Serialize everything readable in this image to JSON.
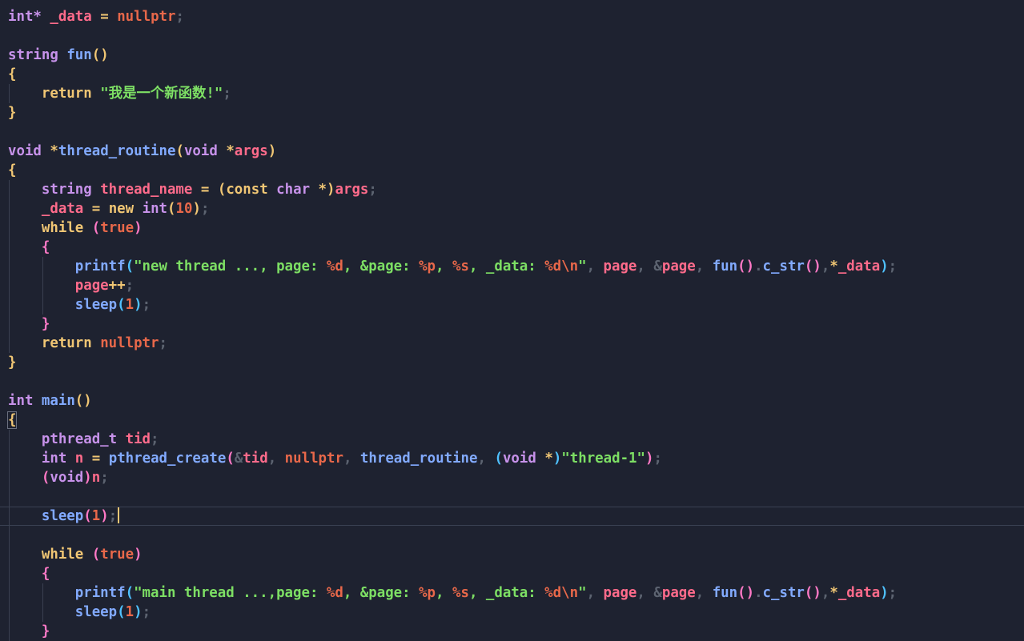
{
  "editor": {
    "lines": [
      [
        [
          "int*",
          "#c792ea"
        ],
        [
          " ",
          ""
        ],
        [
          "_data",
          "#ff6b8b"
        ],
        [
          " ",
          ""
        ],
        [
          "=",
          "#f0c674"
        ],
        [
          " ",
          ""
        ],
        [
          "nullptr",
          "#e8684a"
        ],
        [
          ";",
          "#5c6370"
        ]
      ],
      [],
      [
        [
          "string",
          "#c792ea"
        ],
        [
          " ",
          ""
        ],
        [
          "fun",
          "#82aaff"
        ],
        [
          "()",
          "#f0c674"
        ]
      ],
      [
        [
          "{",
          "#f0c674"
        ]
      ],
      [
        [
          "    ",
          ""
        ],
        [
          "return",
          "#f0c674"
        ],
        [
          " ",
          ""
        ],
        [
          "\"我是一个新函数!\"",
          "#7ddf64"
        ],
        [
          ";",
          "#5c6370"
        ]
      ],
      [
        [
          "}",
          "#f0c674"
        ]
      ],
      [],
      [
        [
          "void",
          "#c792ea"
        ],
        [
          " ",
          ""
        ],
        [
          "*",
          "#f0c674"
        ],
        [
          "thread_routine",
          "#82aaff"
        ],
        [
          "(",
          "#f0c674"
        ],
        [
          "void",
          "#c792ea"
        ],
        [
          " ",
          ""
        ],
        [
          "*",
          "#f0c674"
        ],
        [
          "args",
          "#ff6b8b"
        ],
        [
          ")",
          "#f0c674"
        ]
      ],
      [
        [
          "{",
          "#f0c674"
        ]
      ],
      [
        [
          "    ",
          ""
        ],
        [
          "string",
          "#c792ea"
        ],
        [
          " ",
          ""
        ],
        [
          "thread_name",
          "#ff6b8b"
        ],
        [
          " ",
          ""
        ],
        [
          "=",
          "#f0c674"
        ],
        [
          " ",
          ""
        ],
        [
          "(",
          "#f0c674"
        ],
        [
          "const",
          "#f0c674"
        ],
        [
          " ",
          ""
        ],
        [
          "char",
          "#c792ea"
        ],
        [
          " ",
          ""
        ],
        [
          "*",
          "#f0c674"
        ],
        [
          ")",
          "#f0c674"
        ],
        [
          "args",
          "#ff6b8b"
        ],
        [
          ";",
          "#5c6370"
        ]
      ],
      [
        [
          "    ",
          ""
        ],
        [
          "_data",
          "#ff6b8b"
        ],
        [
          " ",
          ""
        ],
        [
          "=",
          "#f0c674"
        ],
        [
          " ",
          ""
        ],
        [
          "new",
          "#f0c674"
        ],
        [
          " ",
          ""
        ],
        [
          "int",
          "#c792ea"
        ],
        [
          "(",
          "#f0c674"
        ],
        [
          "10",
          "#e8684a"
        ],
        [
          ")",
          "#f0c674"
        ],
        [
          ";",
          "#5c6370"
        ]
      ],
      [
        [
          "    ",
          ""
        ],
        [
          "while",
          "#f0c674"
        ],
        [
          " ",
          ""
        ],
        [
          "(",
          "#ff79c6"
        ],
        [
          "true",
          "#e8684a"
        ],
        [
          ")",
          "#ff79c6"
        ]
      ],
      [
        [
          "    ",
          ""
        ],
        [
          "{",
          "#ff79c6"
        ]
      ],
      [
        [
          "        ",
          ""
        ],
        [
          "printf",
          "#82aaff"
        ],
        [
          "(",
          "#4fc1ff"
        ],
        [
          "\"new thread ..., page: ",
          "#7ddf64"
        ],
        [
          "%d",
          "#e8684a"
        ],
        [
          ", &page: ",
          "#7ddf64"
        ],
        [
          "%p",
          "#e8684a"
        ],
        [
          ", ",
          "#7ddf64"
        ],
        [
          "%s",
          "#e8684a"
        ],
        [
          ", _data: ",
          "#7ddf64"
        ],
        [
          "%d",
          "#e8684a"
        ],
        [
          "\\n",
          "#e8684a"
        ],
        [
          "\"",
          "#7ddf64"
        ],
        [
          ", ",
          "#5c6370"
        ],
        [
          "page",
          "#ff6b8b"
        ],
        [
          ", ",
          "#5c6370"
        ],
        [
          "&",
          "#5c6370"
        ],
        [
          "page",
          "#ff6b8b"
        ],
        [
          ", ",
          "#5c6370"
        ],
        [
          "fun",
          "#82aaff"
        ],
        [
          "()",
          "#ff79c6"
        ],
        [
          ".",
          "#5c6370"
        ],
        [
          "c_str",
          "#82aaff"
        ],
        [
          "()",
          "#ff79c6"
        ],
        [
          ",",
          "#5c6370"
        ],
        [
          "*",
          "#f0c674"
        ],
        [
          "_data",
          "#ff6b8b"
        ],
        [
          ")",
          "#4fc1ff"
        ],
        [
          ";",
          "#5c6370"
        ]
      ],
      [
        [
          "        ",
          ""
        ],
        [
          "page",
          "#ff6b8b"
        ],
        [
          "++",
          "#f0c674"
        ],
        [
          ";",
          "#5c6370"
        ]
      ],
      [
        [
          "        ",
          ""
        ],
        [
          "sleep",
          "#82aaff"
        ],
        [
          "(",
          "#4fc1ff"
        ],
        [
          "1",
          "#e8684a"
        ],
        [
          ")",
          "#4fc1ff"
        ],
        [
          ";",
          "#5c6370"
        ]
      ],
      [
        [
          "    ",
          ""
        ],
        [
          "}",
          "#ff79c6"
        ]
      ],
      [
        [
          "    ",
          ""
        ],
        [
          "return",
          "#f0c674"
        ],
        [
          " ",
          ""
        ],
        [
          "nullptr",
          "#e8684a"
        ],
        [
          ";",
          "#5c6370"
        ]
      ],
      [
        [
          "}",
          "#f0c674"
        ]
      ],
      [],
      [
        [
          "int",
          "#c792ea"
        ],
        [
          " ",
          ""
        ],
        [
          "main",
          "#82aaff"
        ],
        [
          "()",
          "#f0c674"
        ]
      ],
      [
        [
          "{",
          "#f0c674"
        ]
      ],
      [
        [
          "    ",
          ""
        ],
        [
          "pthread_t",
          "#c792ea"
        ],
        [
          " ",
          ""
        ],
        [
          "tid",
          "#ff6b8b"
        ],
        [
          ";",
          "#5c6370"
        ]
      ],
      [
        [
          "    ",
          ""
        ],
        [
          "int",
          "#c792ea"
        ],
        [
          " ",
          ""
        ],
        [
          "n",
          "#ff6b8b"
        ],
        [
          " ",
          ""
        ],
        [
          "=",
          "#f0c674"
        ],
        [
          " ",
          ""
        ],
        [
          "pthread_create",
          "#82aaff"
        ],
        [
          "(",
          "#ff79c6"
        ],
        [
          "&",
          "#5c6370"
        ],
        [
          "tid",
          "#ff6b8b"
        ],
        [
          ", ",
          "#5c6370"
        ],
        [
          "nullptr",
          "#e8684a"
        ],
        [
          ", ",
          "#5c6370"
        ],
        [
          "thread_routine",
          "#82aaff"
        ],
        [
          ", ",
          "#5c6370"
        ],
        [
          "(",
          "#4fc1ff"
        ],
        [
          "void",
          "#c792ea"
        ],
        [
          " ",
          ""
        ],
        [
          "*",
          "#f0c674"
        ],
        [
          ")",
          "#4fc1ff"
        ],
        [
          "\"thread-1\"",
          "#7ddf64"
        ],
        [
          ")",
          "#ff79c6"
        ],
        [
          ";",
          "#5c6370"
        ]
      ],
      [
        [
          "    ",
          ""
        ],
        [
          "(",
          "#ff79c6"
        ],
        [
          "void",
          "#c792ea"
        ],
        [
          ")",
          "#ff79c6"
        ],
        [
          "n",
          "#ff6b8b"
        ],
        [
          ";",
          "#5c6370"
        ]
      ],
      [],
      [
        [
          "    ",
          ""
        ],
        [
          "sleep",
          "#82aaff"
        ],
        [
          "(",
          "#ff79c6"
        ],
        [
          "1",
          "#e8684a"
        ],
        [
          ")",
          "#ff79c6"
        ],
        [
          ";",
          "#5c6370"
        ]
      ],
      [],
      [
        [
          "    ",
          ""
        ],
        [
          "while",
          "#f0c674"
        ],
        [
          " ",
          ""
        ],
        [
          "(",
          "#ff79c6"
        ],
        [
          "true",
          "#e8684a"
        ],
        [
          ")",
          "#ff79c6"
        ]
      ],
      [
        [
          "    ",
          ""
        ],
        [
          "{",
          "#ff79c6"
        ]
      ],
      [
        [
          "        ",
          ""
        ],
        [
          "printf",
          "#82aaff"
        ],
        [
          "(",
          "#4fc1ff"
        ],
        [
          "\"main thread ...,page: ",
          "#7ddf64"
        ],
        [
          "%d",
          "#e8684a"
        ],
        [
          ", &page: ",
          "#7ddf64"
        ],
        [
          "%p",
          "#e8684a"
        ],
        [
          ", ",
          "#7ddf64"
        ],
        [
          "%s",
          "#e8684a"
        ],
        [
          ", _data: ",
          "#7ddf64"
        ],
        [
          "%d",
          "#e8684a"
        ],
        [
          "\\n",
          "#e8684a"
        ],
        [
          "\"",
          "#7ddf64"
        ],
        [
          ", ",
          "#5c6370"
        ],
        [
          "page",
          "#ff6b8b"
        ],
        [
          ", ",
          "#5c6370"
        ],
        [
          "&",
          "#5c6370"
        ],
        [
          "page",
          "#ff6b8b"
        ],
        [
          ", ",
          "#5c6370"
        ],
        [
          "fun",
          "#82aaff"
        ],
        [
          "()",
          "#ff79c6"
        ],
        [
          ".",
          "#5c6370"
        ],
        [
          "c_str",
          "#82aaff"
        ],
        [
          "()",
          "#ff79c6"
        ],
        [
          ",",
          "#5c6370"
        ],
        [
          "*",
          "#f0c674"
        ],
        [
          "_data",
          "#ff6b8b"
        ],
        [
          ")",
          "#4fc1ff"
        ],
        [
          ";",
          "#5c6370"
        ]
      ],
      [
        [
          "        ",
          ""
        ],
        [
          "sleep",
          "#82aaff"
        ],
        [
          "(",
          "#4fc1ff"
        ],
        [
          "1",
          "#e8684a"
        ],
        [
          ")",
          "#4fc1ff"
        ],
        [
          ";",
          "#5c6370"
        ]
      ],
      [
        [
          "    ",
          ""
        ],
        [
          "}",
          "#ff79c6"
        ]
      ]
    ],
    "current_line": 26,
    "background": "#1e2230"
  }
}
